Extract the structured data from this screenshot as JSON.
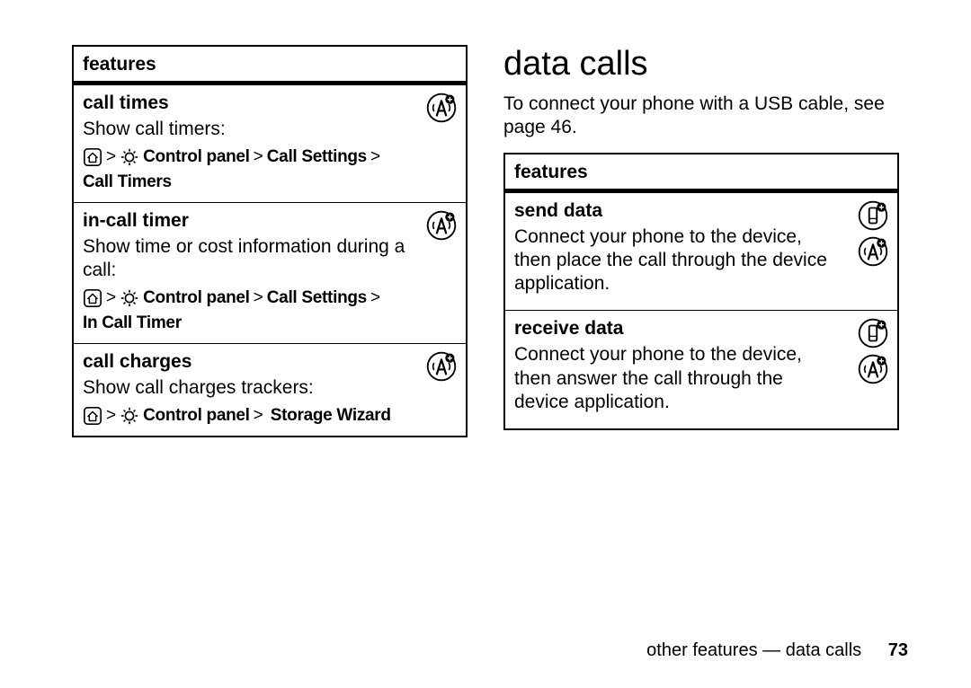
{
  "left_box": {
    "header": "features",
    "rows": [
      {
        "title": "call times",
        "desc": "Show call timers:",
        "path": [
          "Control panel",
          "Call Settings",
          "Call Timers"
        ],
        "icons": [
          "antenna"
        ]
      },
      {
        "title": "in-call timer",
        "desc": "Show time or cost information during a call:",
        "path": [
          "Control panel",
          "Call Settings",
          "In Call Timer"
        ],
        "icons": [
          "antenna"
        ]
      },
      {
        "title": "call charges",
        "desc": "Show call charges trackers:",
        "path": [
          "Control panel",
          "Storage Wizard"
        ],
        "icons": [
          "antenna"
        ]
      }
    ]
  },
  "right": {
    "heading": "data calls",
    "intro": "To connect your phone with a USB cable, see page 46.",
    "box": {
      "header": "features",
      "rows": [
        {
          "title": "send data",
          "desc": "Connect your phone to the device, then place the call through the device application.",
          "icons": [
            "device",
            "antenna"
          ]
        },
        {
          "title": "receive data",
          "desc": "Connect your phone to the device, then answer the call through the device application.",
          "icons": [
            "device",
            "antenna"
          ]
        }
      ]
    }
  },
  "footer": {
    "text": "other features — data calls",
    "page": "73"
  },
  "glyphs": {
    "gt": ">"
  }
}
